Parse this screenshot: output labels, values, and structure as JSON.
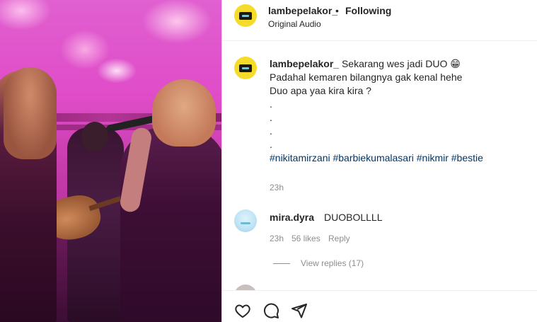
{
  "post": {
    "username": "lambepelakor_",
    "separator": "•",
    "follow_status": "Following",
    "audio": "Original Audio"
  },
  "caption": {
    "username": "lambepelakor_",
    "line1": "Sekarang wes jadi DUO 😁",
    "line2": "Padahal kemaren bilangnya gak kenal hehe",
    "line3": "Duo apa yaa kira kira ?",
    "dots": [
      ".",
      ".",
      ".",
      "."
    ],
    "hashtags": "#nikitamirzani #barbiekumalasari #nikmir #bestie",
    "time": "23h"
  },
  "comments": [
    {
      "username": "mira.dyra",
      "text": "DUOBOLLLL",
      "time": "23h",
      "likes": "56 likes",
      "reply_label": "Reply",
      "view_replies": "View replies (17)"
    }
  ],
  "actions": {
    "like_icon": "heart-icon",
    "comment_icon": "comment-icon",
    "share_icon": "send-icon"
  },
  "colors": {
    "avatar_bg": "#f5dc2a",
    "link": "#00376b",
    "muted": "#8e8e8e",
    "media_accent": "#e04cc8"
  }
}
